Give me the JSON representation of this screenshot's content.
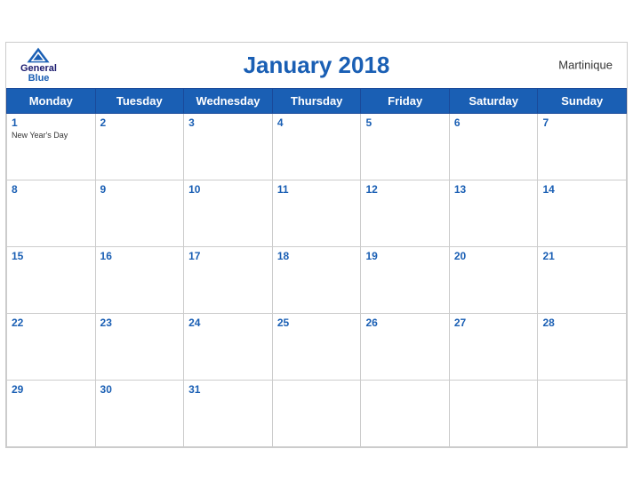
{
  "header": {
    "title": "January 2018",
    "region": "Martinique",
    "logo": {
      "line1": "General",
      "line2": "Blue"
    }
  },
  "weekdays": [
    "Monday",
    "Tuesday",
    "Wednesday",
    "Thursday",
    "Friday",
    "Saturday",
    "Sunday"
  ],
  "weeks": [
    [
      {
        "day": "1",
        "holiday": "New Year's Day"
      },
      {
        "day": "2"
      },
      {
        "day": "3"
      },
      {
        "day": "4"
      },
      {
        "day": "5"
      },
      {
        "day": "6"
      },
      {
        "day": "7"
      }
    ],
    [
      {
        "day": "8"
      },
      {
        "day": "9"
      },
      {
        "day": "10"
      },
      {
        "day": "11"
      },
      {
        "day": "12"
      },
      {
        "day": "13"
      },
      {
        "day": "14"
      }
    ],
    [
      {
        "day": "15"
      },
      {
        "day": "16"
      },
      {
        "day": "17"
      },
      {
        "day": "18"
      },
      {
        "day": "19"
      },
      {
        "day": "20"
      },
      {
        "day": "21"
      }
    ],
    [
      {
        "day": "22"
      },
      {
        "day": "23"
      },
      {
        "day": "24"
      },
      {
        "day": "25"
      },
      {
        "day": "26"
      },
      {
        "day": "27"
      },
      {
        "day": "28"
      }
    ],
    [
      {
        "day": "29"
      },
      {
        "day": "30"
      },
      {
        "day": "31"
      },
      {
        "day": "",
        "empty": true
      },
      {
        "day": "",
        "empty": true
      },
      {
        "day": "",
        "empty": true
      },
      {
        "day": "",
        "empty": true
      }
    ]
  ],
  "accent_color": "#1a5fb4"
}
